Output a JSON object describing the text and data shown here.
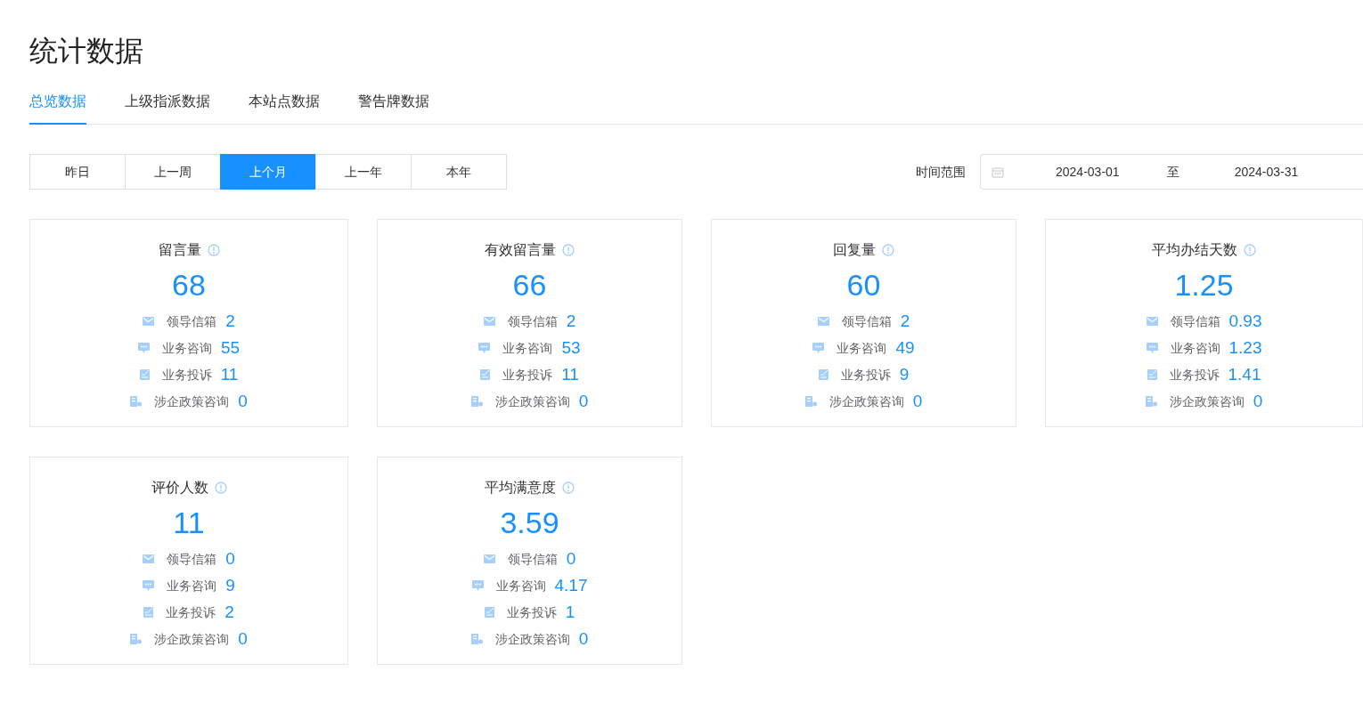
{
  "page_title": "统计数据",
  "tabs": [
    {
      "label": "总览数据",
      "selected": true
    },
    {
      "label": "上级指派数据",
      "selected": false
    },
    {
      "label": "本站点数据",
      "selected": false
    },
    {
      "label": "警告牌数据",
      "selected": false
    }
  ],
  "periods": [
    {
      "label": "昨日",
      "selected": false
    },
    {
      "label": "上一周",
      "selected": false
    },
    {
      "label": "上个月",
      "selected": true
    },
    {
      "label": "上一年",
      "selected": false
    },
    {
      "label": "本年",
      "selected": false
    }
  ],
  "date_range": {
    "label": "时间范围",
    "start": "2024-03-01",
    "separator": "至",
    "end": "2024-03-31"
  },
  "cards": [
    {
      "title": "留言量",
      "value": "68",
      "items": [
        {
          "kind": "mail",
          "label": "领导信箱",
          "value": "2"
        },
        {
          "kind": "chat",
          "label": "业务咨询",
          "value": "55"
        },
        {
          "kind": "complaint",
          "label": "业务投诉",
          "value": "11"
        },
        {
          "kind": "enterprise",
          "label": "涉企政策咨询",
          "value": "0"
        }
      ]
    },
    {
      "title": "有效留言量",
      "value": "66",
      "items": [
        {
          "kind": "mail",
          "label": "领导信箱",
          "value": "2"
        },
        {
          "kind": "chat",
          "label": "业务咨询",
          "value": "53"
        },
        {
          "kind": "complaint",
          "label": "业务投诉",
          "value": "11"
        },
        {
          "kind": "enterprise",
          "label": "涉企政策咨询",
          "value": "0"
        }
      ]
    },
    {
      "title": "回复量",
      "value": "60",
      "items": [
        {
          "kind": "mail",
          "label": "领导信箱",
          "value": "2"
        },
        {
          "kind": "chat",
          "label": "业务咨询",
          "value": "49"
        },
        {
          "kind": "complaint",
          "label": "业务投诉",
          "value": "9"
        },
        {
          "kind": "enterprise",
          "label": "涉企政策咨询",
          "value": "0"
        }
      ]
    },
    {
      "title": "平均办结天数",
      "value": "1.25",
      "items": [
        {
          "kind": "mail",
          "label": "领导信箱",
          "value": "0.93"
        },
        {
          "kind": "chat",
          "label": "业务咨询",
          "value": "1.23"
        },
        {
          "kind": "complaint",
          "label": "业务投诉",
          "value": "1.41"
        },
        {
          "kind": "enterprise",
          "label": "涉企政策咨询",
          "value": "0"
        }
      ]
    },
    {
      "title": "评价人数",
      "value": "11",
      "items": [
        {
          "kind": "mail",
          "label": "领导信箱",
          "value": "0"
        },
        {
          "kind": "chat",
          "label": "业务咨询",
          "value": "9"
        },
        {
          "kind": "complaint",
          "label": "业务投诉",
          "value": "2"
        },
        {
          "kind": "enterprise",
          "label": "涉企政策咨询",
          "value": "0"
        }
      ]
    },
    {
      "title": "平均满意度",
      "value": "3.59",
      "items": [
        {
          "kind": "mail",
          "label": "领导信箱",
          "value": "0"
        },
        {
          "kind": "chat",
          "label": "业务咨询",
          "value": "4.17"
        },
        {
          "kind": "complaint",
          "label": "业务投诉",
          "value": "1"
        },
        {
          "kind": "enterprise",
          "label": "涉企政策咨询",
          "value": "0"
        }
      ]
    }
  ]
}
